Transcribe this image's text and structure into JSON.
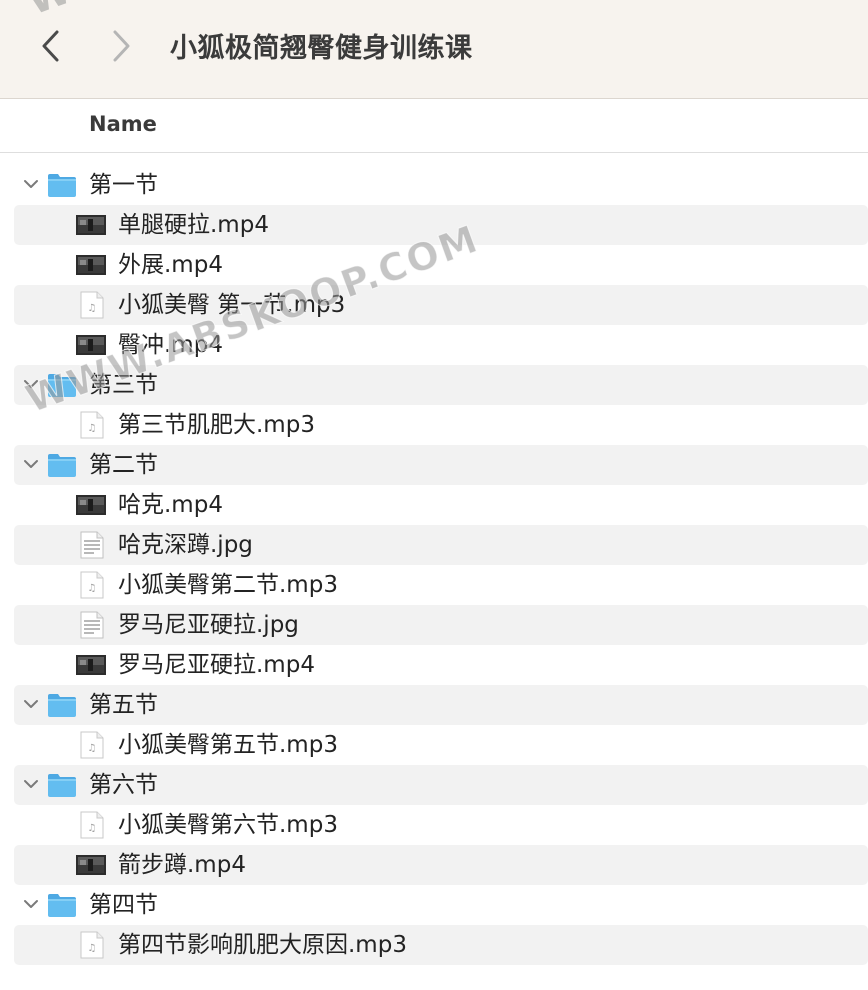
{
  "window": {
    "title": "小狐极简翘臀健身训练课",
    "back_icon": "chevron-left-icon",
    "forward_icon": "chevron-right-icon"
  },
  "header": {
    "name_column": "Name"
  },
  "colors": {
    "toolbar_bg": "#f7f3ee",
    "folder_blue": "#5ab4ea",
    "row_alt": "#f2f2f2",
    "text": "#232323"
  },
  "rows": [
    {
      "kind": "folder",
      "label": "第一节",
      "expanded": true
    },
    {
      "kind": "file",
      "label": "单腿硬拉.mp4",
      "icon": "video-thumbnail-icon"
    },
    {
      "kind": "file",
      "label": "外展.mp4",
      "icon": "video-thumbnail-icon"
    },
    {
      "kind": "file",
      "label": "小狐美臀 第一节.mp3",
      "icon": "audio-file-icon"
    },
    {
      "kind": "file",
      "label": "臀冲.mp4",
      "icon": "video-thumbnail-icon"
    },
    {
      "kind": "folder",
      "label": "第三节",
      "expanded": true
    },
    {
      "kind": "file",
      "label": "第三节肌肥大.mp3",
      "icon": "audio-file-icon"
    },
    {
      "kind": "folder",
      "label": "第二节",
      "expanded": true
    },
    {
      "kind": "file",
      "label": "哈克.mp4",
      "icon": "video-thumbnail-icon"
    },
    {
      "kind": "file",
      "label": "哈克深蹲.jpg",
      "icon": "image-document-icon"
    },
    {
      "kind": "file",
      "label": "小狐美臀第二节.mp3",
      "icon": "audio-file-icon"
    },
    {
      "kind": "file",
      "label": "罗马尼亚硬拉.jpg",
      "icon": "image-document-icon"
    },
    {
      "kind": "file",
      "label": "罗马尼亚硬拉.mp4",
      "icon": "video-thumbnail-icon"
    },
    {
      "kind": "folder",
      "label": "第五节",
      "expanded": true
    },
    {
      "kind": "file",
      "label": "小狐美臀第五节.mp3",
      "icon": "audio-file-icon"
    },
    {
      "kind": "folder",
      "label": "第六节",
      "expanded": true
    },
    {
      "kind": "file",
      "label": "小狐美臀第六节.mp3",
      "icon": "audio-file-icon"
    },
    {
      "kind": "file",
      "label": "箭步蹲.mp4",
      "icon": "video-thumbnail-icon"
    },
    {
      "kind": "folder",
      "label": "第四节",
      "expanded": true
    },
    {
      "kind": "file",
      "label": "第四节影响肌肥大原因.mp3",
      "icon": "audio-file-icon"
    }
  ],
  "watermark": {
    "text": "WWW.ABSKOOP.COM",
    "top_fragment": "WW"
  }
}
